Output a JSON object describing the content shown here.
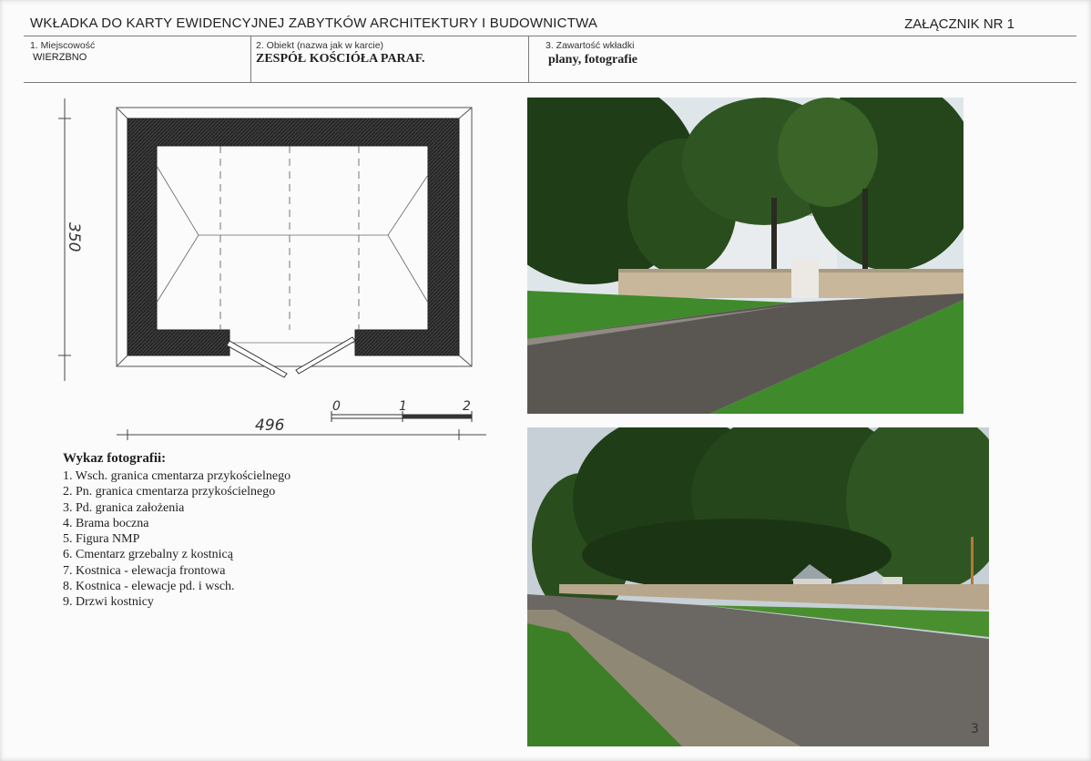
{
  "header": {
    "title": "WKŁADKA DO KARTY EWIDENCYJNEJ ZABYTKÓW ARCHITEKTURY I BUDOWNICTWA",
    "annex": "ZAŁĄCZNIK NR 1"
  },
  "fields": [
    {
      "label": "1. Miejscowość",
      "value": "WIERZBNO"
    },
    {
      "label": "2. Obiekt (nazwa jak w karcie)",
      "value": "ZESPÓŁ KOŚCIÓŁA PARAF."
    },
    {
      "label": "3. Zawartość wkładki",
      "value": "plany, fotografie"
    }
  ],
  "plan": {
    "height_dimension": "350",
    "width_dimension": "496",
    "scale_labels": [
      "0",
      "1",
      "2"
    ]
  },
  "photo_list": {
    "title": "Wykaz fotografii:",
    "items": [
      "1. Wsch. granica cmentarza przykościelnego",
      "2. Pn. granica cmentarza przykościelnego",
      "3. Pd. granica założenia",
      "4. Brama boczna",
      "5. Figura NMP",
      "6. Cmentarz grzebalny z kostnicą",
      "7. Kostnica - elewacja frontowa",
      "8. Kostnica - elewacje pd. i wsch.",
      "9. Drzwi kostnicy"
    ]
  },
  "photos": {
    "page_number": "3"
  },
  "colors": {
    "rule": "#7a7a7a",
    "wall": "#333333",
    "grass": "#3f8a2a",
    "foliage": "#1f3d17",
    "road": "#5a5752",
    "sky": "#dfe6ea"
  }
}
